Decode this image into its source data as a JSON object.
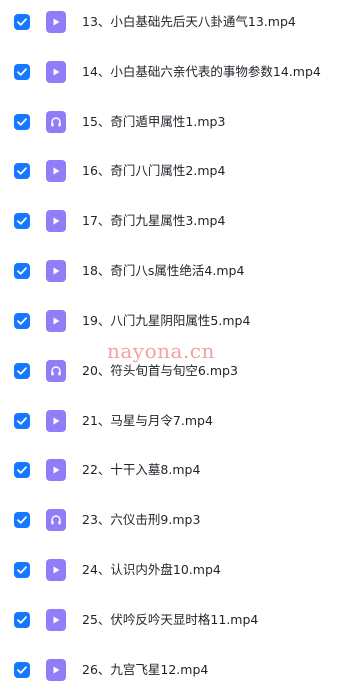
{
  "files": [
    {
      "name": "13、小白基础先后天八卦通气13.mp4",
      "type": "video",
      "icon": "video-file-icon",
      "checked": true
    },
    {
      "name": "14、小白基础六亲代表的事物参数14.mp4",
      "type": "video",
      "icon": "video-file-icon",
      "checked": true
    },
    {
      "name": "15、奇门遁甲属性1.mp3",
      "type": "audio",
      "icon": "audio-file-icon",
      "checked": true
    },
    {
      "name": "16、奇门八门属性2.mp4",
      "type": "video",
      "icon": "video-file-icon",
      "checked": true
    },
    {
      "name": "17、奇门九星属性3.mp4",
      "type": "video",
      "icon": "video-file-icon",
      "checked": true
    },
    {
      "name": "18、奇门八s属性绝活4.mp4",
      "type": "video",
      "icon": "video-file-icon",
      "checked": true
    },
    {
      "name": "19、八门九星阴阳属性5.mp4",
      "type": "video",
      "icon": "video-file-icon",
      "checked": true
    },
    {
      "name": "20、符头旬首与旬空6.mp3",
      "type": "audio",
      "icon": "audio-file-icon",
      "checked": true
    },
    {
      "name": "21、马星与月令7.mp4",
      "type": "video",
      "icon": "video-file-icon",
      "checked": true
    },
    {
      "name": "22、十干入墓8.mp4",
      "type": "video",
      "icon": "video-file-icon",
      "checked": true
    },
    {
      "name": "23、六仪击刑9.mp3",
      "type": "audio",
      "icon": "audio-file-icon",
      "checked": true
    },
    {
      "name": "24、认识内外盘10.mp4",
      "type": "video",
      "icon": "video-file-icon",
      "checked": true
    },
    {
      "name": "25、伏吟反吟天显时格11.mp4",
      "type": "video",
      "icon": "video-file-icon",
      "checked": true
    },
    {
      "name": "26、九宫飞星12.mp4",
      "type": "video",
      "icon": "video-file-icon",
      "checked": true
    }
  ],
  "watermark": "nayona.cn",
  "colors": {
    "checkbox": "#1677ff",
    "file_icon": "#8f7ef8",
    "text": "#1f2329",
    "watermark": "#f08a8a"
  }
}
